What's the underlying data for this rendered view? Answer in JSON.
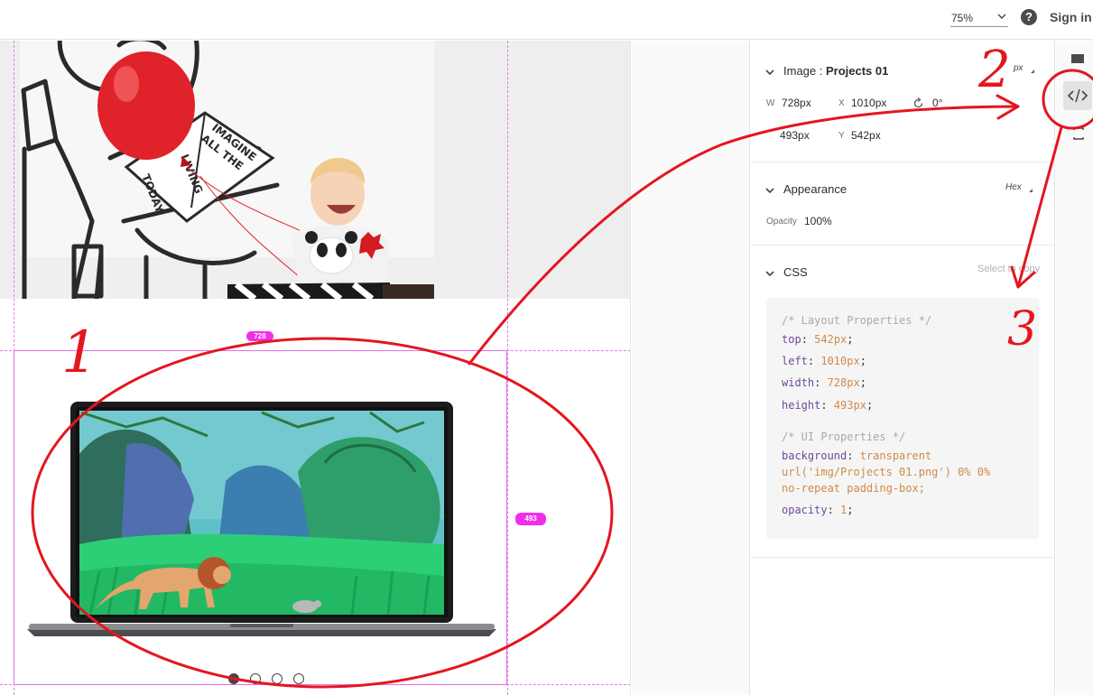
{
  "topbar": {
    "zoom_value": "75%",
    "help_glyph": "?",
    "signin_label": "Sign in"
  },
  "canvas": {
    "width_badge": "728",
    "height_badge": "493",
    "carousel": {
      "dot_count": 4,
      "active_index": 0
    },
    "photo_book_text": [
      "IMAGINE",
      "ALL THE",
      "LIVING",
      "TODAY"
    ]
  },
  "panel": {
    "image_section": {
      "title_prefix": "Image : ",
      "title_name": "Projects 01",
      "unit": "px",
      "w_label": "W",
      "w_value": "728px",
      "x_label": "X",
      "x_value": "1010px",
      "rotation_value": "0°",
      "h_value": "493px",
      "y_label": "Y",
      "y_value": "542px"
    },
    "appearance": {
      "title": "Appearance",
      "unit": "Hex",
      "opacity_label": "Opacity",
      "opacity_value": "100%"
    },
    "css": {
      "title": "CSS",
      "copy_label": "Select to copy",
      "comment_layout": "/* Layout Properties */",
      "lines_layout": [
        {
          "prop": "top",
          "val": "542px"
        },
        {
          "prop": "left",
          "val": "1010px"
        },
        {
          "prop": "width",
          "val": "728px"
        },
        {
          "prop": "height",
          "val": "493px"
        }
      ],
      "comment_ui": "/* UI Properties */",
      "bg_prop": "background",
      "bg_val_1": "transparent",
      "bg_val_2": "url('img/Projects 01.png') 0% 0%",
      "bg_val_3": "no-repeat padding-box;",
      "opacity_prop": "opacity",
      "opacity_val": "1"
    }
  },
  "annotations": {
    "label_1": "1",
    "label_2": "2",
    "label_3": "3",
    "color": "#e4161e"
  },
  "colors": {
    "guide": "#e37ce8",
    "badge": "#f12fe9",
    "code_property": "#6e4a9e",
    "code_value": "#d08a48",
    "code_comment": "#a9a9a9"
  }
}
